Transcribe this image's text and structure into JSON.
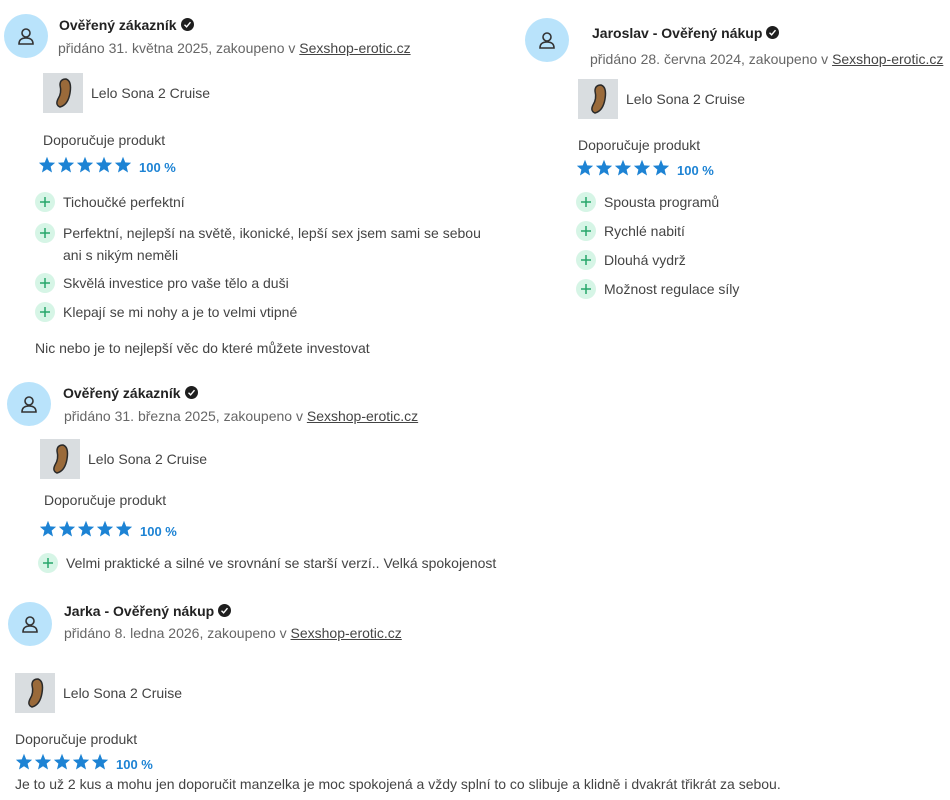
{
  "colors": {
    "accent": "#1d83d4",
    "avatar_bg": "#b9e3fb",
    "plus_bg": "#d6f5e6",
    "plus": "#26a66a"
  },
  "reviews": [
    {
      "author": "Ověřený zákazník",
      "meta_prefix": "přidáno 31. května 2025, zakoupeno v ",
      "shop": "Sexshop-erotic.cz",
      "product": "Lelo Sona 2 Cruise",
      "recommend": "Doporučuje produkt",
      "rating_pct": "100 %",
      "stars": 5,
      "pros": [
        "Tichoučké perfektní",
        "Perfektní, nejlepší na světě, ikonické, lepší sex jsem sami se sebou ani s nikým neměli",
        "Skvělá investice pro vaše tělo a duši",
        "Klepají se mi nohy a je to velmi vtipné"
      ],
      "comment": "Nic nebo je to nejlepší věc do které můžete investovat"
    },
    {
      "author": "Jaroslav - Ověřený nákup",
      "meta_prefix": "přidáno 28. června 2024, zakoupeno v ",
      "shop": "Sexshop-erotic.cz",
      "product": "Lelo Sona 2 Cruise",
      "recommend": "Doporučuje produkt",
      "rating_pct": "100 %",
      "stars": 5,
      "pros": [
        "Spousta programů",
        "Rychlé nabití",
        "Dlouhá vydrž",
        "Možnost regulace síly"
      ]
    },
    {
      "author": "Ověřený zákazník",
      "meta_prefix": "přidáno 31. března 2025, zakoupeno v ",
      "shop": "Sexshop-erotic.cz",
      "product": "Lelo Sona 2 Cruise",
      "recommend": "Doporučuje produkt",
      "rating_pct": "100 %",
      "stars": 5,
      "pros": [
        "Velmi praktické a silné ve srovnání se starší verzí.. Velká spokojenost"
      ]
    },
    {
      "author": "Jarka - Ověřený nákup",
      "meta_prefix": "přidáno 8. ledna 2026, zakoupeno v ",
      "shop": "Sexshop-erotic.cz",
      "product": "Lelo Sona 2 Cruise",
      "recommend": "Doporučuje produkt",
      "rating_pct": "100 %",
      "stars": 5,
      "comment": "Je to už 2 kus a mohu jen doporučit manzelka je moc spokojená a vždy splní to co slibuje a klidně i dvakrát třikrát za sebou."
    }
  ]
}
